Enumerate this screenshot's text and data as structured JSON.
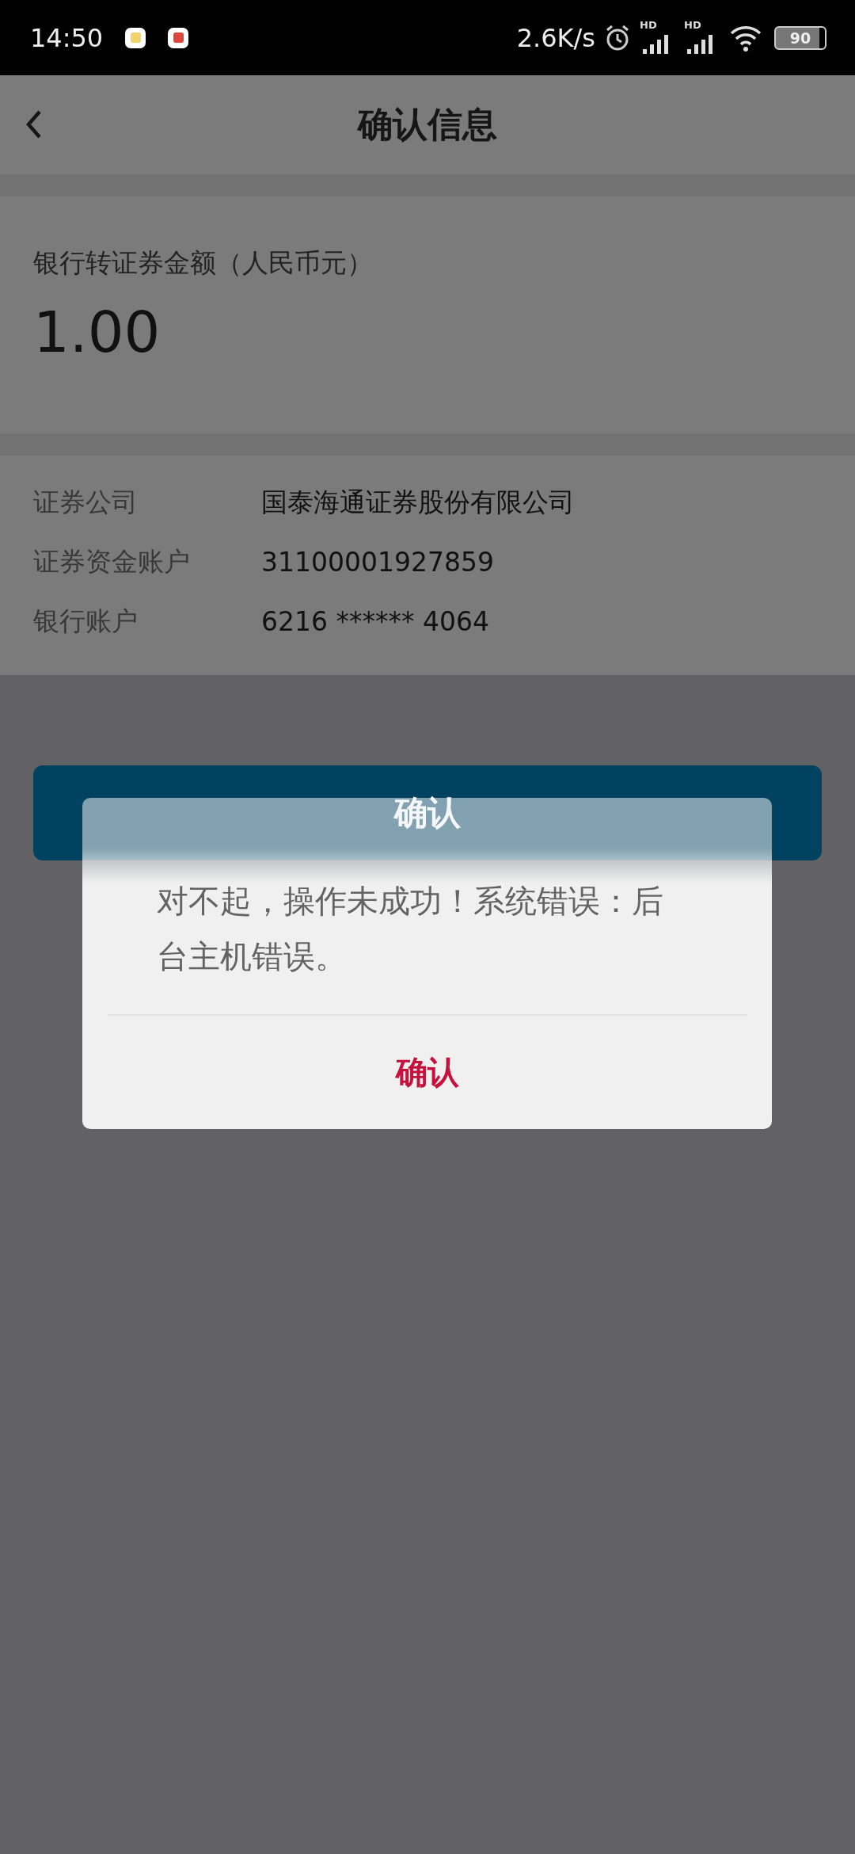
{
  "status_bar": {
    "time": "14:50",
    "speed": "2.6K/s",
    "signals": [
      {
        "label": "HD"
      },
      {
        "label": "HD"
      }
    ],
    "battery": "90"
  },
  "header": {
    "title": "确认信息"
  },
  "amount": {
    "label": "银行转证券金额（人民币元）",
    "value": "1.00"
  },
  "details": [
    {
      "label": "证券公司",
      "value": "国泰海通证券股份有限公司"
    },
    {
      "label": "证券资金账户",
      "value": "31100001927859"
    },
    {
      "label": "银行账户",
      "value": "6216 ****** 4064"
    }
  ],
  "confirm_button": {
    "label": "确认"
  },
  "dialog": {
    "message": "对不起，操作未成功！系统错误：后台主机错误。",
    "button": "确认"
  }
}
